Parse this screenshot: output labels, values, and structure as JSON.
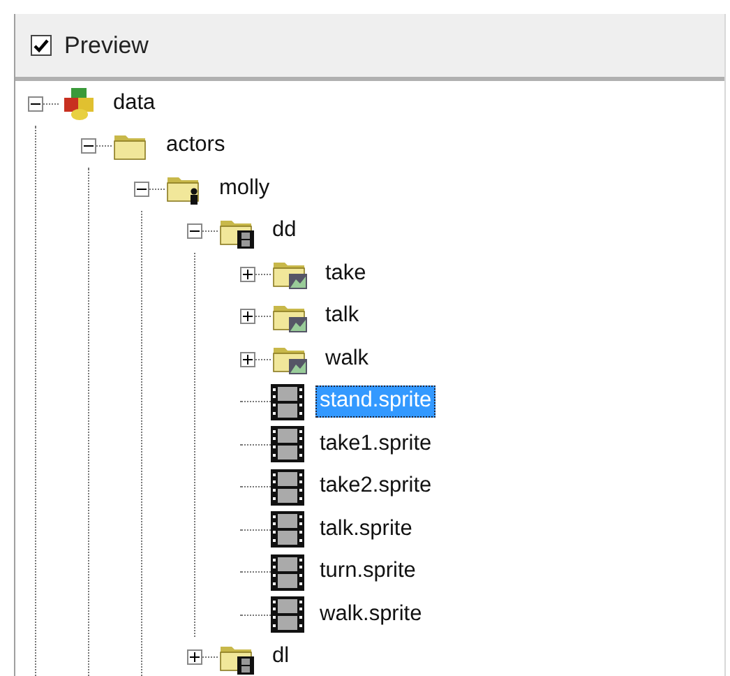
{
  "preview": {
    "label": "Preview",
    "checked": true
  },
  "tree": [
    {
      "label": "data",
      "kind": "database",
      "expanded": true,
      "selected": false,
      "children": [
        {
          "label": "actors",
          "kind": "folder",
          "expanded": true,
          "selected": false,
          "children": [
            {
              "label": "molly",
              "kind": "actor",
              "expanded": true,
              "selected": false,
              "children": [
                {
                  "label": "dd",
                  "kind": "film-folder",
                  "expanded": true,
                  "selected": false,
                  "children": [
                    {
                      "label": "take",
                      "kind": "image-folder",
                      "expanded": false,
                      "selected": false
                    },
                    {
                      "label": "talk",
                      "kind": "image-folder",
                      "expanded": false,
                      "selected": false
                    },
                    {
                      "label": "walk",
                      "kind": "image-folder",
                      "expanded": false,
                      "selected": false
                    },
                    {
                      "label": "stand.sprite",
                      "kind": "sprite",
                      "selected": true
                    },
                    {
                      "label": "take1.sprite",
                      "kind": "sprite",
                      "selected": false
                    },
                    {
                      "label": "take2.sprite",
                      "kind": "sprite",
                      "selected": false
                    },
                    {
                      "label": "talk.sprite",
                      "kind": "sprite",
                      "selected": false
                    },
                    {
                      "label": "turn.sprite",
                      "kind": "sprite",
                      "selected": false
                    },
                    {
                      "label": "walk.sprite",
                      "kind": "sprite",
                      "selected": false
                    }
                  ]
                },
                {
                  "label": "dl",
                  "kind": "film-folder",
                  "expanded": false,
                  "selected": false
                }
              ]
            }
          ]
        }
      ]
    }
  ]
}
